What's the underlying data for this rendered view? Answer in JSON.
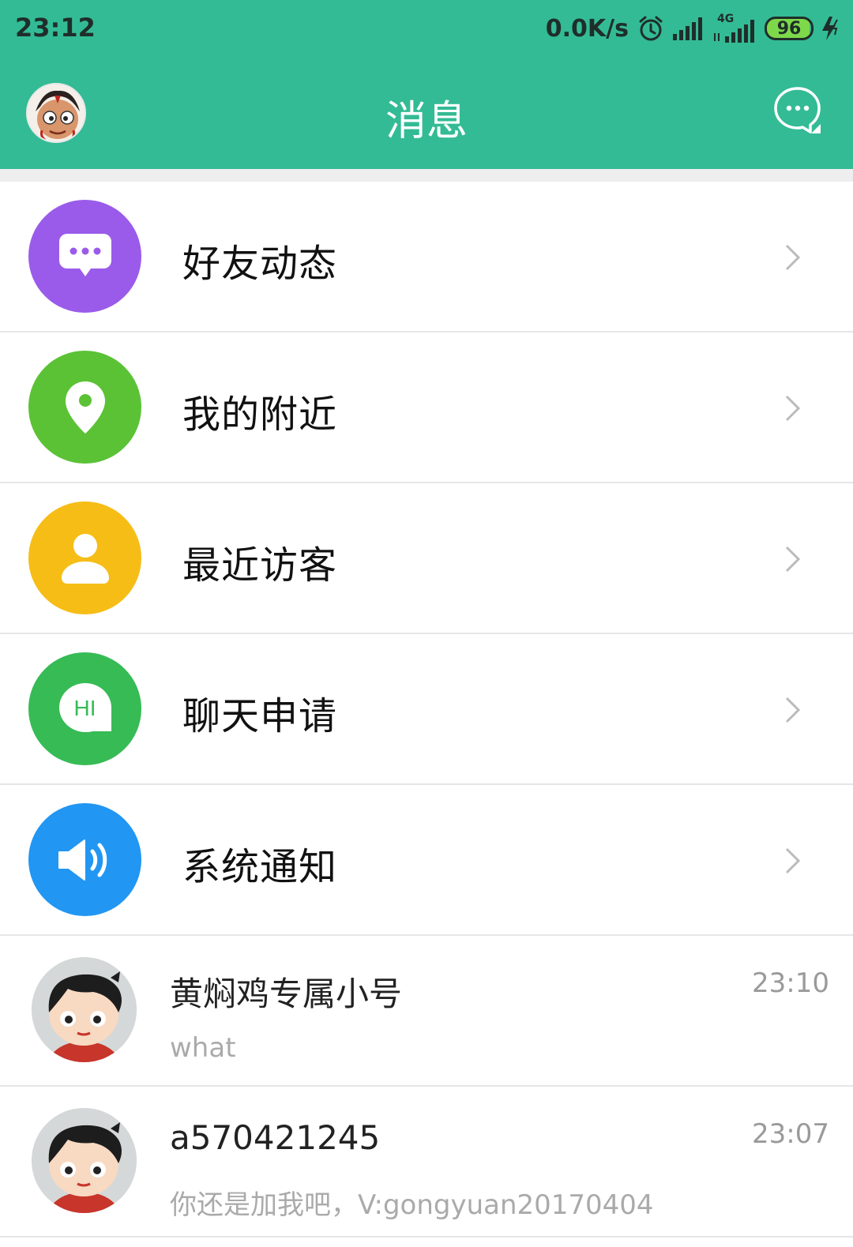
{
  "status_bar": {
    "time": "23:12",
    "net_speed": "0.0K/s",
    "network_type": "4G",
    "battery": "96",
    "icons": [
      "alarm-icon",
      "signal-icon",
      "signal-4g-icon",
      "battery-icon",
      "charging-icon"
    ]
  },
  "header": {
    "title": "消息",
    "bg_color": "#33bb95",
    "right_icon": "chat-bubble-icon"
  },
  "menu": [
    {
      "label": "好友动态",
      "icon": "message-dots-icon",
      "color": "#9a5bea"
    },
    {
      "label": "我的附近",
      "icon": "location-pin-icon",
      "color": "#5bc236"
    },
    {
      "label": "最近访客",
      "icon": "person-icon",
      "color": "#f6bd16"
    },
    {
      "label": "聊天申请",
      "icon": "hi-bubble-icon",
      "color": "#37bb55",
      "icon_text": "HI"
    },
    {
      "label": "系统通知",
      "icon": "speaker-icon",
      "color": "#2196f3"
    }
  ],
  "conversations": [
    {
      "name": "黄焖鸡专属小号",
      "message": "what",
      "time": "23:10"
    },
    {
      "name": "a570421245",
      "message": "你还是加我吧，V:gongyuan20170404",
      "time": "23:07"
    }
  ]
}
